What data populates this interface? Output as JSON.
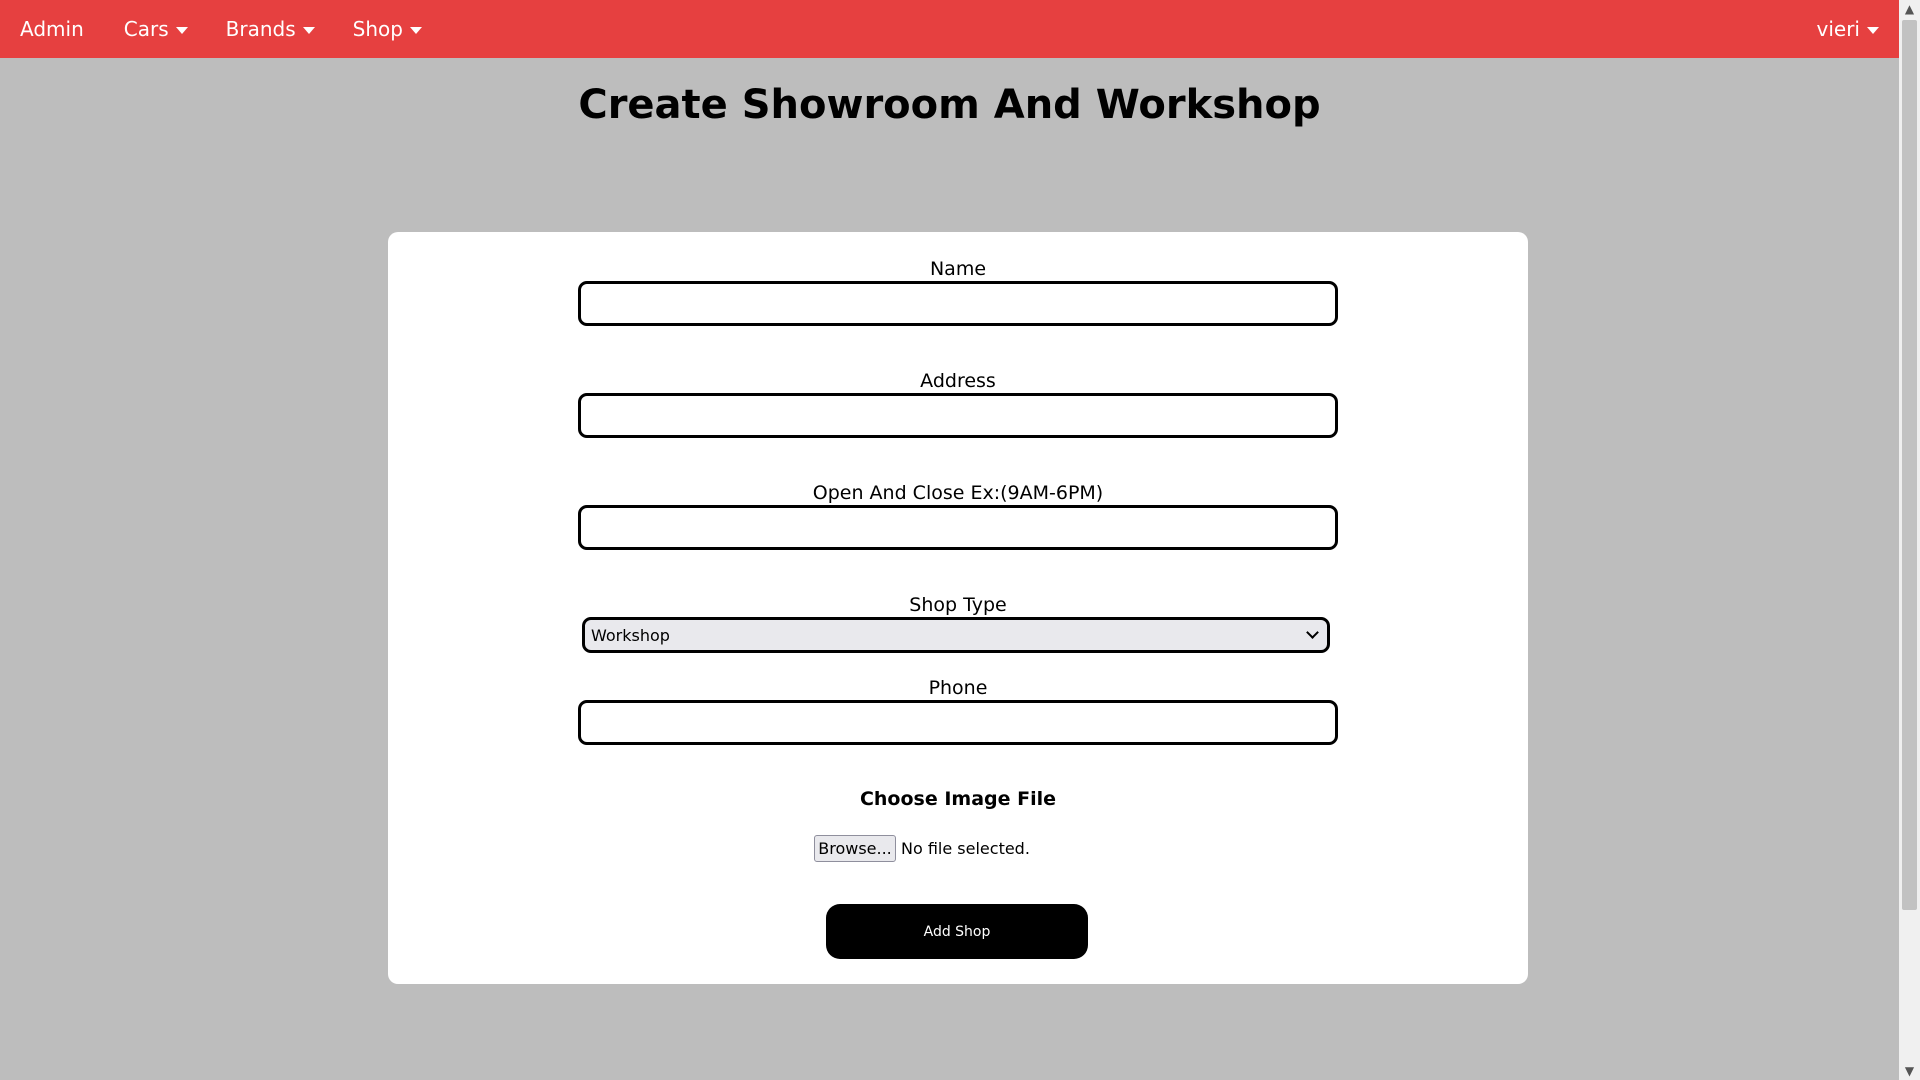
{
  "navbar": {
    "brand": "Admin",
    "items": [
      {
        "label": "Cars"
      },
      {
        "label": "Brands"
      },
      {
        "label": "Shop"
      }
    ],
    "user": "vieri",
    "color": "#e64040"
  },
  "page": {
    "title": "Create Showroom And Workshop"
  },
  "form": {
    "name_label": "Name",
    "name_value": "",
    "address_label": "Address",
    "address_value": "",
    "hours_label": "Open And Close Ex:(9AM-6PM)",
    "hours_value": "",
    "shop_type_label": "Shop Type",
    "shop_type_selected": "Workshop",
    "phone_label": "Phone",
    "phone_value": "",
    "image_label": "Choose Image File",
    "browse_label": "Browse...",
    "file_status": "No file selected.",
    "submit_label": "Add Shop"
  }
}
